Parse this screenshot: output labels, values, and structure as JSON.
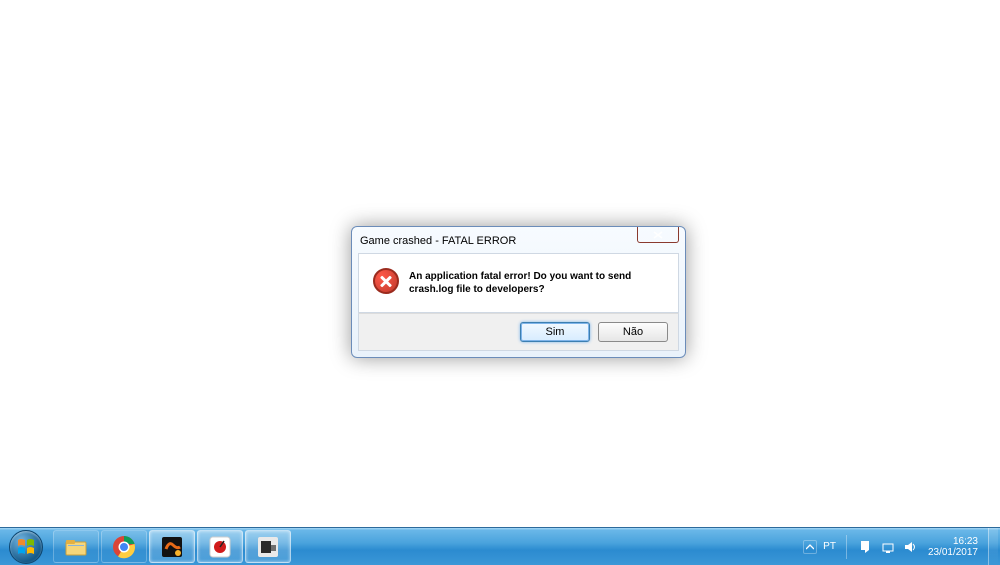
{
  "dialog": {
    "title": "Game crashed - FATAL ERROR",
    "message": "An application fatal error! Do you want to send crash.log file to developers?",
    "buttons": {
      "yes": "Sim",
      "no": "Não"
    }
  },
  "taskbar": {
    "apps": [
      {
        "name": "explorer",
        "color1": "#f6d67a",
        "color2": "#e3b043"
      },
      {
        "name": "chrome"
      },
      {
        "name": "blender",
        "color1": "#e86a17",
        "color2": "#2b5aa0"
      },
      {
        "name": "bandicam",
        "color1": "#d11b1b"
      },
      {
        "name": "other",
        "color1": "#2a2a2a",
        "color2": "#6e6e6e"
      }
    ]
  },
  "tray": {
    "lang": "PT",
    "time": "16:23",
    "date": "23/01/2017"
  }
}
